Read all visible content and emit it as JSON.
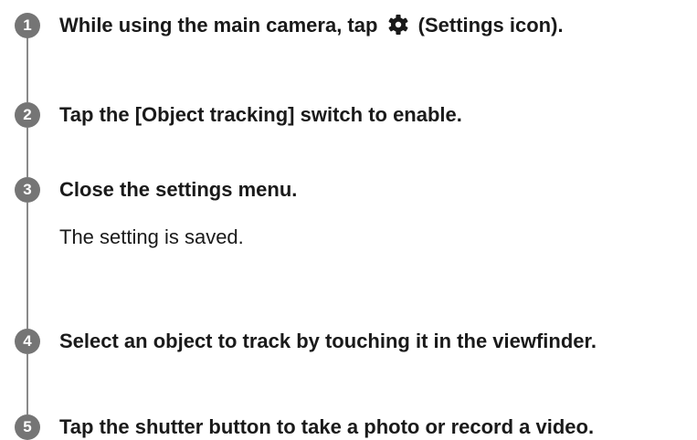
{
  "steps": [
    {
      "number": "1",
      "title_before_icon": "While using the main camera, tap",
      "icon": "gear-icon",
      "title_after_icon": "(Settings icon)."
    },
    {
      "number": "2",
      "title": "Tap the [Object tracking] switch to enable."
    },
    {
      "number": "3",
      "title": "Close the settings menu.",
      "note": "The setting is saved."
    },
    {
      "number": "4",
      "title": "Select an object to track by touching it in the viewfinder."
    },
    {
      "number": "5",
      "title": "Tap the shutter button to take a photo or record a video."
    }
  ],
  "colors": {
    "badge": "#757575",
    "line": "#8a8a8a",
    "text": "#1a1a1a"
  }
}
